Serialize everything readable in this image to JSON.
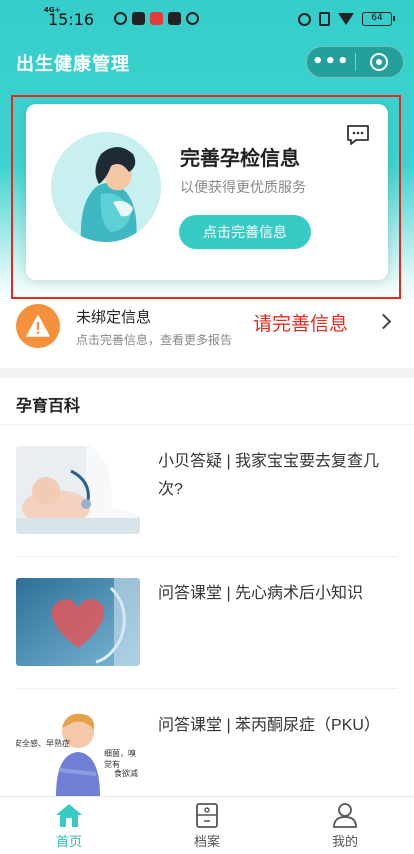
{
  "status_bar": {
    "time": "15:16",
    "network": "4G+",
    "battery": "64"
  },
  "app": {
    "title": "出生健康管理",
    "capsule_more": "•••"
  },
  "card": {
    "title": "完善孕检信息",
    "subtitle": "以便获得更优质服务",
    "button_label": "点击完善信息"
  },
  "notice": {
    "title": "未绑定信息",
    "description": "点击完善信息，查看更多报告",
    "annotation": "请完善信息"
  },
  "section": {
    "title": "孕育百科"
  },
  "articles": [
    {
      "title": "小贝答疑 | 我家宝宝要去复查几次?"
    },
    {
      "title": "问答课堂 | 先心病术后小知识"
    },
    {
      "title": "问答课堂 | 苯丙酮尿症（PKU）"
    }
  ],
  "article_image_text": {
    "left": "安全感、早熟症",
    "right_top": "细菌，嗅觉有",
    "right_bottom": "食欲减"
  },
  "tabbar": {
    "items": [
      {
        "label": "首页",
        "icon": "home-icon",
        "active": true
      },
      {
        "label": "档案",
        "icon": "file-cabinet-icon",
        "active": false
      },
      {
        "label": "我的",
        "icon": "person-icon",
        "active": false
      }
    ]
  },
  "colors": {
    "brand": "#38cbc6",
    "annotation": "#e8281f",
    "warning": "#f5913d",
    "active_tab": "#2fb9b5"
  }
}
